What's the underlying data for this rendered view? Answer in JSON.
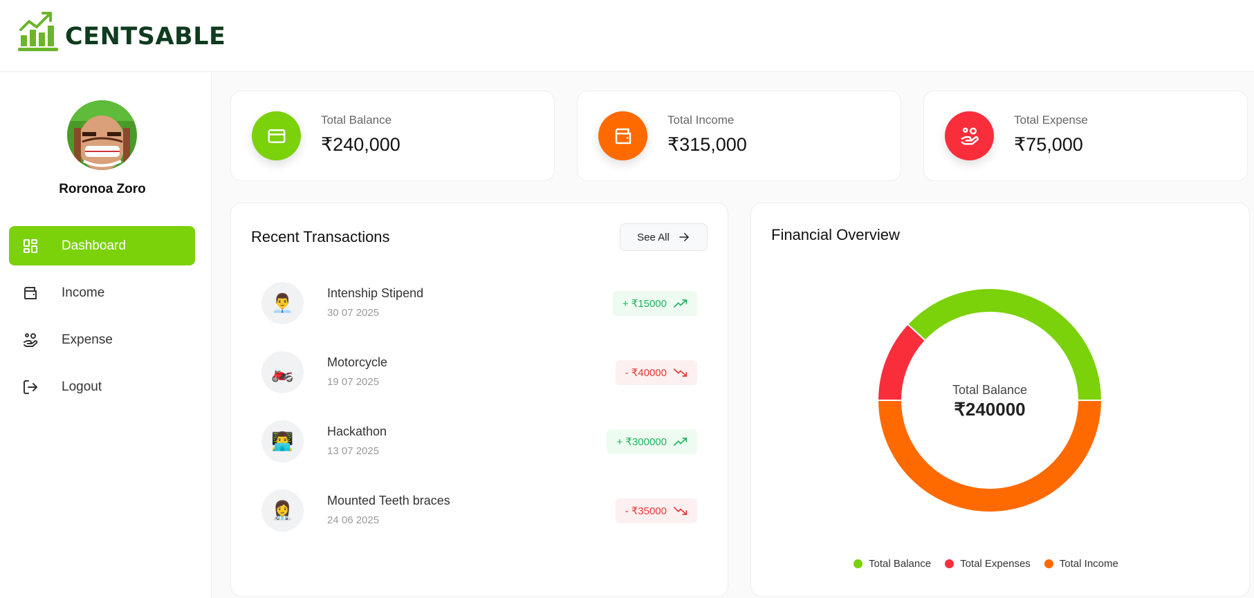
{
  "app": {
    "name": "CENTSABLE"
  },
  "user": {
    "name": "Roronoa Zoro"
  },
  "sidebar": {
    "items": [
      {
        "label": "Dashboard",
        "icon": "dashboard-icon",
        "active": true
      },
      {
        "label": "Income",
        "icon": "wallet-icon",
        "active": false
      },
      {
        "label": "Expense",
        "icon": "hand-coins-icon",
        "active": false
      },
      {
        "label": "Logout",
        "icon": "logout-icon",
        "active": false
      }
    ]
  },
  "stats": [
    {
      "label": "Total Balance",
      "value": "₹240,000",
      "icon": "credit-card-icon",
      "color": "#7bd10a"
    },
    {
      "label": "Total Income",
      "value": "₹315,000",
      "icon": "wallet-icon",
      "color": "#ff6a00"
    },
    {
      "label": "Total Expense",
      "value": "₹75,000",
      "icon": "hand-coins-icon",
      "color": "#fa2d3b"
    }
  ],
  "transactions": {
    "title": "Recent Transactions",
    "see_all": "See All",
    "items": [
      {
        "title": "Intenship Stipend",
        "date": "30 07 2025",
        "amount": "+ ₹15000",
        "type": "income",
        "icon": "👨‍💼"
      },
      {
        "title": "Motorcycle",
        "date": "19 07 2025",
        "amount": "- ₹40000",
        "type": "expense",
        "icon": "🏍️"
      },
      {
        "title": "Hackathon",
        "date": "13 07 2025",
        "amount": "+ ₹300000",
        "type": "income",
        "icon": "👨‍💻"
      },
      {
        "title": "Mounted Teeth braces",
        "date": "24 06 2025",
        "amount": "- ₹35000",
        "type": "expense",
        "icon": "👩‍⚕️"
      }
    ]
  },
  "overview": {
    "title": "Financial Overview",
    "center_label": "Total Balance",
    "center_value": "₹240000"
  },
  "chart_data": {
    "type": "pie",
    "title": "Financial Overview",
    "categories": [
      "Total Balance",
      "Total Expenses",
      "Total Income"
    ],
    "values": [
      240000,
      75000,
      315000
    ],
    "colors": [
      "#7bd10a",
      "#fa2d3b",
      "#ff6a00"
    ],
    "legend": "bottom"
  },
  "colors": {
    "accent": "#7bd10a",
    "income": "#ff6a00",
    "expense": "#fa2d3b",
    "brand_text": "#0f3b1e"
  }
}
